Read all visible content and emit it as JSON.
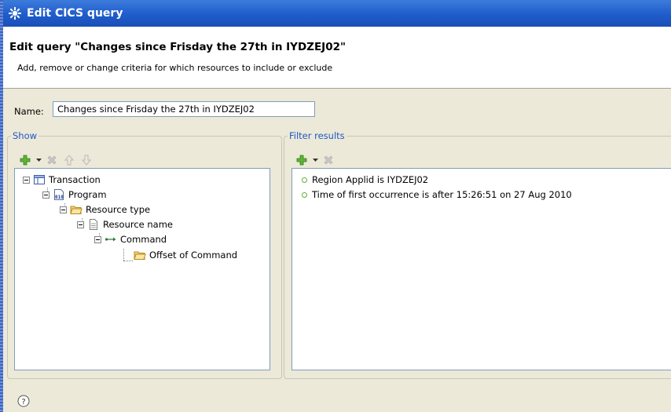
{
  "window": {
    "title": "Edit CICS query"
  },
  "header": {
    "title": "Edit query \"Changes since Frisday the 27th in IYDZEJ02\"",
    "description": "Add, remove or change criteria for which resources to include or exclude"
  },
  "form": {
    "name_label": "Name:",
    "name_value": "Changes since Frisday the 27th in IYDZEJ02"
  },
  "show": {
    "label": "Show",
    "tree": [
      {
        "label": "Transaction",
        "icon": "table-icon"
      },
      {
        "label": "Program",
        "icon": "binary-file-icon"
      },
      {
        "label": "Resource type",
        "icon": "folder-icon"
      },
      {
        "label": "Resource name",
        "icon": "document-icon"
      },
      {
        "label": "Command",
        "icon": "arrow-icon"
      },
      {
        "label": "Offset of Command",
        "icon": "folder-icon"
      }
    ]
  },
  "filter": {
    "label": "Filter results",
    "items": [
      "Region Applid is IYDZEJ02",
      "Time of first occurrence is after 15:26:51 on 27 Aug 2010"
    ]
  }
}
